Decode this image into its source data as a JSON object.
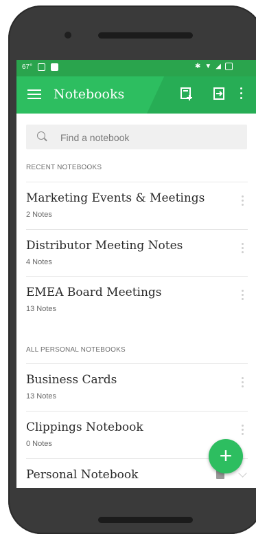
{
  "status": {
    "left_text": "67°"
  },
  "toolbar": {
    "title": "Notebooks"
  },
  "search": {
    "placeholder": "Find a notebook"
  },
  "sections": {
    "recent": "RECENT NOTEBOOKS",
    "personal": "ALL PERSONAL NOTEBOOKS"
  },
  "recent": [
    {
      "name": "Marketing Events & Meetings",
      "count": "2 Notes"
    },
    {
      "name": "Distributor Meeting Notes",
      "count": "4 Notes"
    },
    {
      "name": "EMEA Board Meetings",
      "count": "13 Notes"
    }
  ],
  "personal": [
    {
      "name": "Business Cards",
      "count": "13 Notes"
    },
    {
      "name": "Clippings Notebook",
      "count": "0 Notes"
    },
    {
      "name": "Personal Notebook",
      "count": ""
    }
  ],
  "fab": {
    "label": "+"
  },
  "colors": {
    "accent": "#2dbe60",
    "status_bar": "#2aa44d"
  },
  "icons": [
    "menu-icon",
    "new-notebook-icon",
    "sync-icon",
    "overflow-menu-icon",
    "search-icon",
    "more-options-icon",
    "add-icon"
  ]
}
